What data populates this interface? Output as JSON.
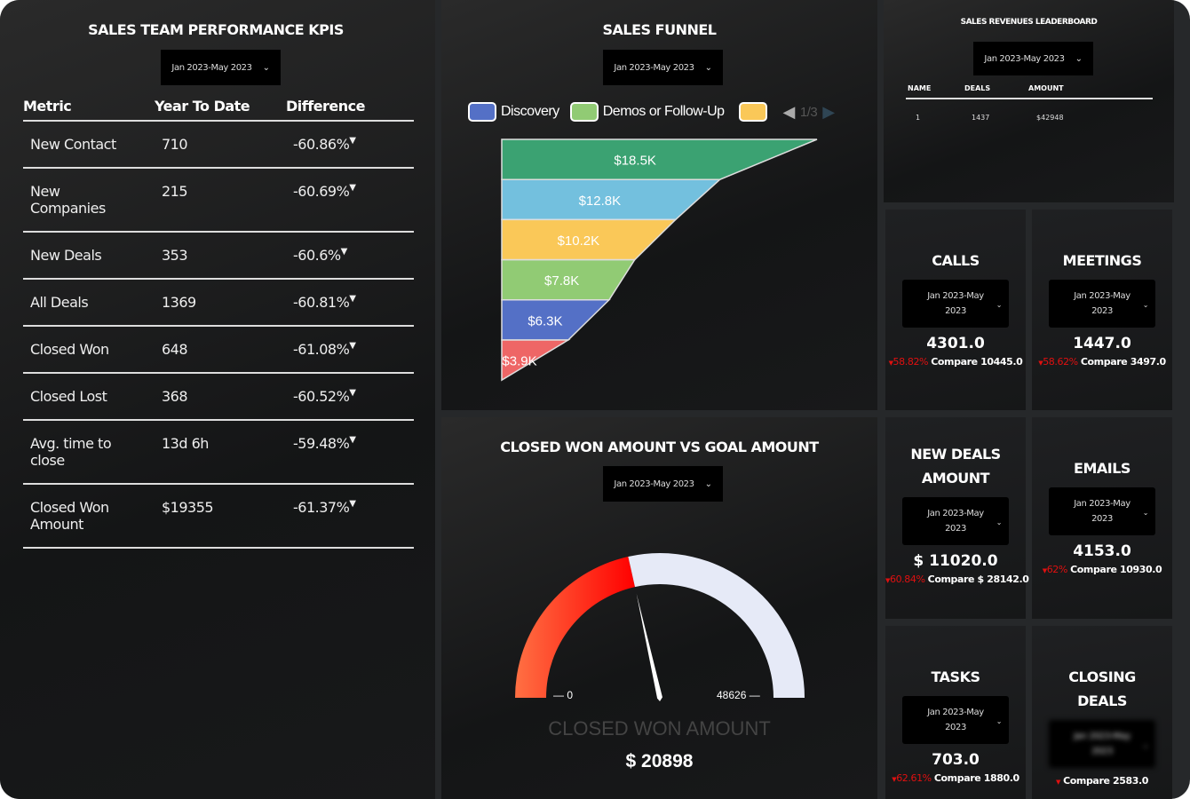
{
  "date_range": "Jan 2023-May 2023",
  "kpi": {
    "title": "SALES TEAM PERFORMANCE KPIS",
    "columns": [
      "Metric",
      "Year To Date",
      "Difference"
    ],
    "rows": [
      {
        "metric": "New Contact",
        "ytd": "710",
        "diff": "-60.86%"
      },
      {
        "metric": "New Companies",
        "ytd": "215",
        "diff": "-60.69%"
      },
      {
        "metric": "New Deals",
        "ytd": "353",
        "diff": "-60.6%"
      },
      {
        "metric": "All Deals",
        "ytd": "1369",
        "diff": "-60.81%"
      },
      {
        "metric": "Closed Won",
        "ytd": "648",
        "diff": "-61.08%"
      },
      {
        "metric": "Closed Lost",
        "ytd": "368",
        "diff": "-60.52%"
      },
      {
        "metric": "Avg. time to close",
        "ytd": "13d 6h",
        "diff": "-59.48%"
      },
      {
        "metric": "Closed Won Amount",
        "ytd": "$19355",
        "diff": "-61.37%"
      }
    ]
  },
  "funnel": {
    "title": "SALES FUNNEL",
    "legend": [
      {
        "name": "Discovery",
        "color": "#5470c6"
      },
      {
        "name": "Demos or Follow-Up",
        "color": "#91cb74"
      },
      {
        "name": "",
        "color": "#fac858"
      }
    ],
    "legend_page": "1/3"
  },
  "chart_data": {
    "type": "funnel",
    "values": [
      18.5,
      12.8,
      10.2,
      7.8,
      6.3,
      3.9
    ],
    "labels": [
      "$18.5K",
      "$12.8K",
      "$10.2K",
      "$7.8K",
      "$6.3K",
      "$3.9K"
    ],
    "colors": [
      "#3ba272",
      "#73c0de",
      "#fac858",
      "#91cb74",
      "#5470c6",
      "#ee6666"
    ]
  },
  "gauge": {
    "title": "CLOSED WON AMOUNT VS GOAL AMOUNT",
    "min": "0",
    "max": "48626",
    "value": 20898,
    "label": "CLOSED WON AMOUNT",
    "value_text": "$ 20898"
  },
  "leaderboard": {
    "title": "SALES REVENUES LEADERBOARD",
    "columns": [
      "NAME",
      "DEALS",
      "AMOUNT"
    ],
    "rows": [
      {
        "name": "1",
        "deals": "1437",
        "amount": "$42948"
      }
    ]
  },
  "cards": [
    {
      "title": "CALLS",
      "value": "4301.0",
      "pct": "58.82%",
      "compare": "Compare 10445.0"
    },
    {
      "title": "MEETINGS",
      "value": "1447.0",
      "pct": "58.62%",
      "compare": "Compare 3497.0"
    },
    {
      "title": "NEW DEALS AMOUNT",
      "value": "$ 11020.0",
      "pct": "60.84%",
      "compare": "Compare $ 28142.0"
    },
    {
      "title": "EMAILS",
      "value": "4153.0",
      "pct": "62%",
      "compare": "Compare 10930.0"
    },
    {
      "title": "TASKS",
      "value": "703.0",
      "pct": "62.61%",
      "compare": "Compare 1880.0"
    },
    {
      "title": "CLOSING DEALS",
      "value": "",
      "pct": "",
      "compare": "Compare 2583.0"
    }
  ]
}
